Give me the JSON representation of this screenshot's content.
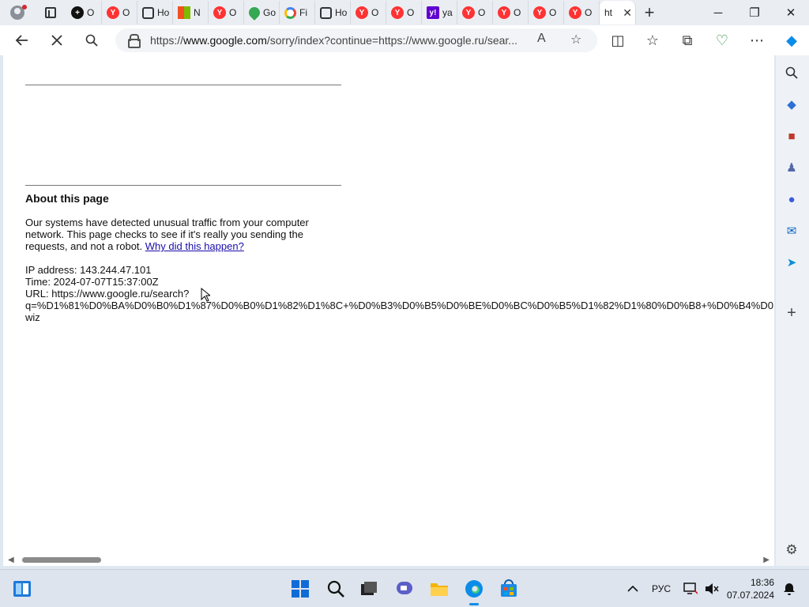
{
  "tabs": [
    {
      "icon": "plus-circle-icon",
      "label": "O"
    },
    {
      "icon": "yandex-icon",
      "label": "O"
    },
    {
      "icon": "gallery-icon",
      "label": "Ho"
    },
    {
      "icon": "microsoft-icon",
      "label": "N"
    },
    {
      "icon": "yandex-icon",
      "label": "O"
    },
    {
      "icon": "maps-icon",
      "label": "Go"
    },
    {
      "icon": "google-icon",
      "label": "Fi"
    },
    {
      "icon": "gallery-icon",
      "label": "Ho"
    },
    {
      "icon": "yandex-icon",
      "label": "O"
    },
    {
      "icon": "yandex-icon",
      "label": "O"
    },
    {
      "icon": "yahoo-icon",
      "label": "ya"
    },
    {
      "icon": "yandex-icon",
      "label": "O"
    },
    {
      "icon": "yandex-icon",
      "label": "O"
    },
    {
      "icon": "yandex-icon",
      "label": "O"
    },
    {
      "icon": "yandex-icon",
      "label": "O"
    }
  ],
  "active_tab": {
    "label": "ht"
  },
  "window_controls": {
    "minimize": "─",
    "restore": "❐",
    "close": "✕"
  },
  "address_bar": {
    "url_prefix": "https://",
    "url_domain": "www.google.com",
    "url_rest": "/sorry/index?continue=https://www.google.ru/sear..."
  },
  "page": {
    "heading": "About this page",
    "message": "Our systems have detected unusual traffic from your computer network. This page checks to see if it's really you sending the requests, and not a robot.",
    "link": "Why did this happen?",
    "ip_line": "IP address: 143.244.47.101",
    "time_line": "Time: 2024-07-07T15:37:00Z",
    "url_line1": "URL: https://www.google.ru/search?",
    "url_line2": "q=%D1%81%D0%BA%D0%B0%D1%87%D0%B0%D1%82%D1%8C+%D0%B3%D0%B5%D0%BE%D0%BC%D0%B5%D1%82%D1%80%D0%B8+%D0%B4%D0",
    "url_line3": "wiz"
  },
  "taskbar": {
    "lang": "РУС",
    "time": "18:36",
    "date": "07.07.2024"
  },
  "colors": {
    "link": "#1a0dab",
    "yandex": "#ff3333",
    "edge_accent": "#0c8ce9"
  }
}
